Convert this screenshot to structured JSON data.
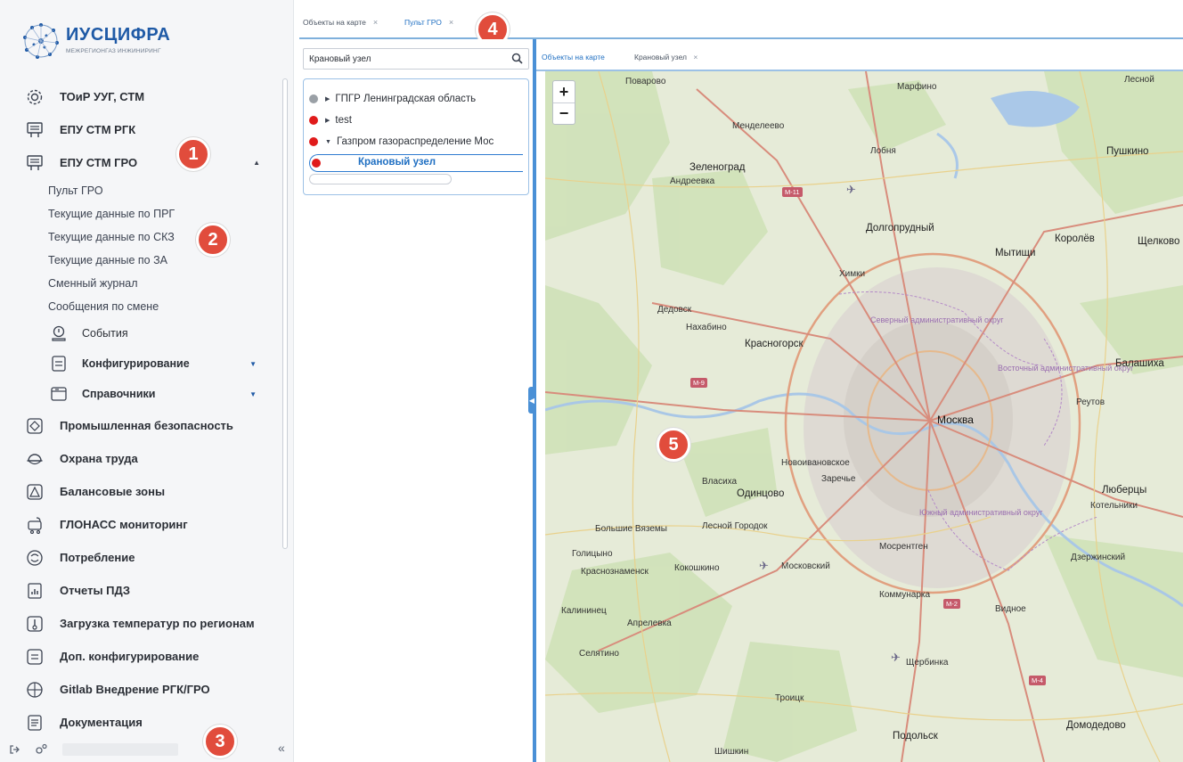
{
  "logo": {
    "name": "ИУСЦИФРА",
    "subtitle": "МЕЖРЕГИОНГАЗ ИНЖИНИРИНГ"
  },
  "sidebar": {
    "items": [
      {
        "label": "ТОиР УУГ, СТМ",
        "icon": "gear-icon"
      },
      {
        "label": "ЕПУ СТМ РГК",
        "icon": "device-icon"
      },
      {
        "label": "ЕПУ СТМ ГРО",
        "icon": "device-icon",
        "expanded": true
      }
    ],
    "subitems": [
      "Пульт ГРО",
      "Текущие данные по ПРГ",
      "Текущие данные по СКЗ",
      "Текущие данные по ЗА",
      "Сменный журнал",
      "Сообщения по смене"
    ],
    "subgroups": [
      {
        "label": "События",
        "icon": "search-doc-icon"
      },
      {
        "label": "Конфигурирование",
        "icon": "server-icon"
      },
      {
        "label": "Справочники",
        "icon": "folder-icon"
      }
    ],
    "modules": [
      {
        "label": "Промышленная безопасность",
        "icon": "shield-icon"
      },
      {
        "label": "Охрана труда",
        "icon": "helmet-icon"
      },
      {
        "label": "Балансовые зоны",
        "icon": "balance-icon"
      },
      {
        "label": "ГЛОНАСС мониторинг",
        "icon": "satellite-icon"
      },
      {
        "label": "Потребление",
        "icon": "consumption-icon"
      },
      {
        "label": "Отчеты ПДЗ",
        "icon": "report-icon"
      },
      {
        "label": "Загрузка температур по регионам",
        "icon": "thermometer-icon"
      },
      {
        "label": "Доп. конфигурирование",
        "icon": "server-icon"
      },
      {
        "label": "Gitlab Внедрение РГК/ГРО",
        "icon": "globe-icon"
      },
      {
        "label": "Документация",
        "icon": "document-icon"
      }
    ]
  },
  "markers": [
    "1",
    "2",
    "3",
    "4",
    "5"
  ],
  "tabs": [
    {
      "label": "Объекты на карте",
      "close": "×"
    },
    {
      "label": "Пульт ГРО",
      "close": "×"
    }
  ],
  "tree": {
    "search_value": "Крановый узел",
    "nodes": [
      {
        "label": "ГПГР Ленинградская область",
        "status_color": "#9aa0a6"
      },
      {
        "label": "test",
        "status_color": "#e01b1b"
      },
      {
        "label": "Газпром газораспределение Мос",
        "status_color": "#e01b1b"
      }
    ],
    "selected": {
      "label": "Крановый узел",
      "status_color": "#e01b1b"
    }
  },
  "map_tabs": [
    {
      "label": "Объекты на карте"
    },
    {
      "label": "Крановый узел",
      "close": "×"
    }
  ],
  "map": {
    "zoom_in": "+",
    "zoom_out": "−",
    "labels": {
      "povarovo": "Поварово",
      "marfino": "Марфино",
      "lesnoy": "Лесной",
      "mendeleevo": "Менделеево",
      "pushkino": "Пушкино",
      "zelenograd": "Зеленоград",
      "andreevka": "Андреевка",
      "lobnya": "Лобня",
      "dolgoprudny": "Долгопрудный",
      "mytishchi": "Мытищи",
      "korolev": "Королёв",
      "shchelkovo": "Щелково",
      "khimki": "Химки",
      "dedovsk": "Дедовск",
      "nakhabino": "Нахабино",
      "krasnogorsk": "Красногорск",
      "balashikha": "Балашиха",
      "moskva": "Москва",
      "reutov": "Реутов",
      "odintsovo": "Одинцово",
      "vlasikha": "Власиха",
      "zarechye": "Заречье",
      "lyubertsy": "Люберцы",
      "kotelniki": "Котельники",
      "bolshie_vyazemy": "Большие Вяземы",
      "golitsyno": "Голицыно",
      "lesnoy_gorodok": "Лесной Городок",
      "krasnoznamensk": "Краснознаменск",
      "kokoshkino": "Кокошкино",
      "moskovsky": "Московский",
      "mosrentgen": "Мосрентген",
      "kommunarka": "Коммунарка",
      "vidnoe": "Видное",
      "dzerzhinsky": "Дзержинский",
      "kalininets": "Калининец",
      "aprelevka": "Апрелевка",
      "selyatino": "Селятино",
      "shcherbinka": "Щербинка",
      "troitsk": "Троицк",
      "podolsk": "Подольск",
      "domodedovo": "Домодедово",
      "novoivanovskoe": "Новоивановское",
      "sheredari": "Шишкин"
    },
    "districts": {
      "severny": "Северный административный округ",
      "vostochny": "Восточный административный округ",
      "yuzhny": "Южный административный округ"
    },
    "shields": {
      "m11": "М-11",
      "m9": "М-9",
      "m2": "М-2",
      "m4": "М-4"
    }
  }
}
